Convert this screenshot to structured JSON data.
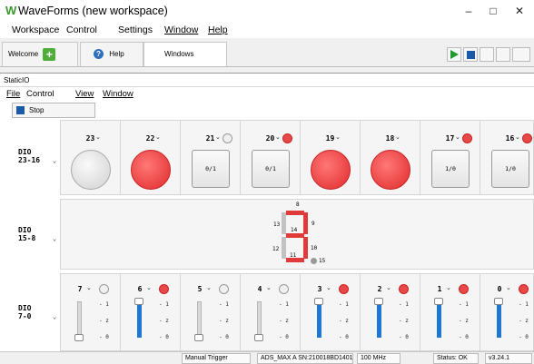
{
  "app": {
    "title": "WaveForms (new workspace)",
    "logo": "W"
  },
  "window_controls": {
    "min": "–",
    "max": "□",
    "close": "✕"
  },
  "menu": [
    "Workspace",
    "Control",
    "Settings",
    "Window",
    "Help"
  ],
  "tabs": {
    "welcome": "Welcome",
    "help": "Help",
    "windows": "Windows"
  },
  "toolbar_icons": [
    "run-icon",
    "stop-icon",
    "window-icon",
    "window-icon",
    "settings-icon"
  ],
  "subwindow": {
    "title": "StaticIO"
  },
  "submenu": [
    "File",
    "Control",
    "View",
    "Window"
  ],
  "stop_label": "Stop",
  "groups": {
    "g1": "DIO\n23-16",
    "g2": "DIO\n15-8",
    "g3": "DIO\n7-0"
  },
  "dio_high": [
    {
      "pin": "23",
      "type": "led",
      "state": "off"
    },
    {
      "pin": "22",
      "type": "led",
      "state": "on"
    },
    {
      "pin": "21",
      "type": "button",
      "state": "off",
      "label": "0/1"
    },
    {
      "pin": "20",
      "type": "button",
      "state": "on",
      "label": "0/1"
    },
    {
      "pin": "19",
      "type": "led",
      "state": "on"
    },
    {
      "pin": "18",
      "type": "led",
      "state": "on"
    },
    {
      "pin": "17",
      "type": "button",
      "state": "on",
      "label": "1/0"
    },
    {
      "pin": "16",
      "type": "button",
      "state": "on",
      "label": "1/0"
    }
  ],
  "seven_segment": {
    "labels": [
      "8",
      "13",
      "14",
      "9",
      "12",
      "11",
      "10",
      "15"
    ],
    "on_segments": [
      "8",
      "14",
      "9",
      "10",
      "11"
    ],
    "dot": "15"
  },
  "dio_low": [
    {
      "pin": "7",
      "state": "off",
      "level": 0
    },
    {
      "pin": "6",
      "state": "on",
      "level": 1
    },
    {
      "pin": "5",
      "state": "off",
      "level": 0
    },
    {
      "pin": "4",
      "state": "off",
      "level": 0
    },
    {
      "pin": "3",
      "state": "on",
      "level": 1
    },
    {
      "pin": "2",
      "state": "on",
      "level": 1
    },
    {
      "pin": "1",
      "state": "on",
      "level": 1
    },
    {
      "pin": "0",
      "state": "on",
      "level": 1
    }
  ],
  "slider_ticks": [
    "- 1",
    "- z",
    "- 0"
  ],
  "statusbar": {
    "trigger": "Manual Trigger",
    "device": "ADS_MAX A SN:210018BD1401",
    "freq": "100 MHz",
    "status": "Status: OK",
    "version": "v3.24.1"
  },
  "colors": {
    "accent": "#1f77d4",
    "led_on": "#e02a2a",
    "run": "#1e9a2e"
  }
}
